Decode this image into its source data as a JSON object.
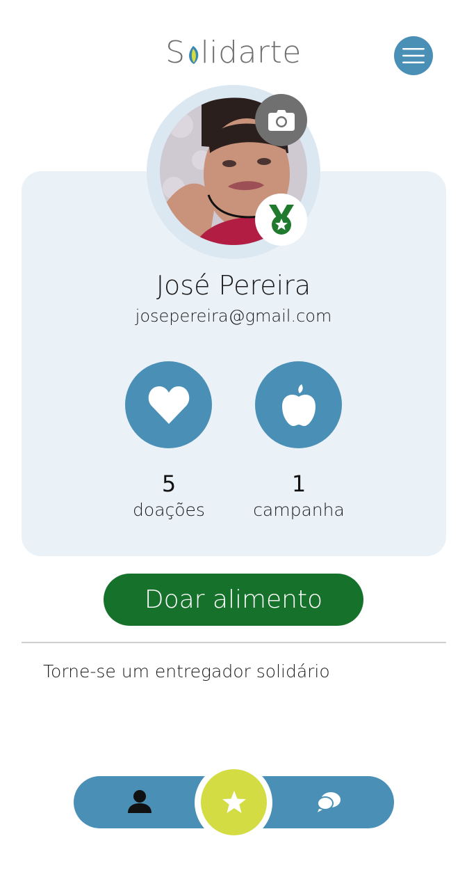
{
  "app": {
    "logo_prefix": "S",
    "logo_suffix": "lidarte"
  },
  "profile": {
    "name": "José Pereira",
    "email": "josepereira@gmail.com"
  },
  "stats": [
    {
      "value": "5",
      "label": "doações",
      "icon": "heart-icon"
    },
    {
      "value": "1",
      "label": "campanha",
      "icon": "apple-icon"
    }
  ],
  "actions": {
    "donate_label": "Doar alimento",
    "courier_link": "Torne-se um entregador solidário"
  },
  "nav": {
    "items": [
      "profile-icon",
      "star-icon",
      "chat-icon"
    ],
    "active": "star-icon"
  },
  "colors": {
    "primary_blue": "#4a8fb6",
    "card_bg": "#ebf2f7",
    "donate_green": "#16722b",
    "accent_yellow": "#d4dc43",
    "medal_green": "#1f7a2e"
  }
}
